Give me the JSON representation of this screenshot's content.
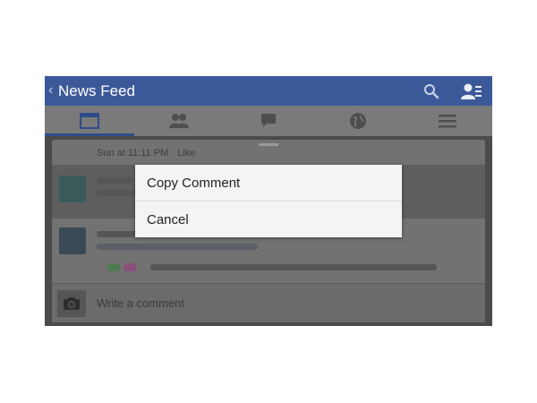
{
  "header": {
    "back_glyph": "‹",
    "title": "News Feed",
    "icons": [
      "search-icon",
      "friend-requests-icon"
    ]
  },
  "tabs": [
    {
      "name": "news-feed",
      "icon": "news-feed-icon",
      "active": true
    },
    {
      "name": "friends",
      "icon": "friends-icon",
      "active": false
    },
    {
      "name": "messages",
      "icon": "messages-icon",
      "active": false
    },
    {
      "name": "notifications",
      "icon": "globe-icon",
      "active": false
    },
    {
      "name": "more",
      "icon": "menu-icon",
      "active": false
    }
  ],
  "post": {
    "timestamp": "Sun at 11:11 PM",
    "like_label": "Like"
  },
  "comment_input": {
    "placeholder": "Write a comment",
    "icon": "camera-icon"
  },
  "context_menu": {
    "items": [
      "Copy Comment",
      "Cancel"
    ]
  },
  "colors": {
    "brand": "#3b5998",
    "dialog_bg": "#f4f4f4",
    "overlay": "#4b4b4b"
  }
}
